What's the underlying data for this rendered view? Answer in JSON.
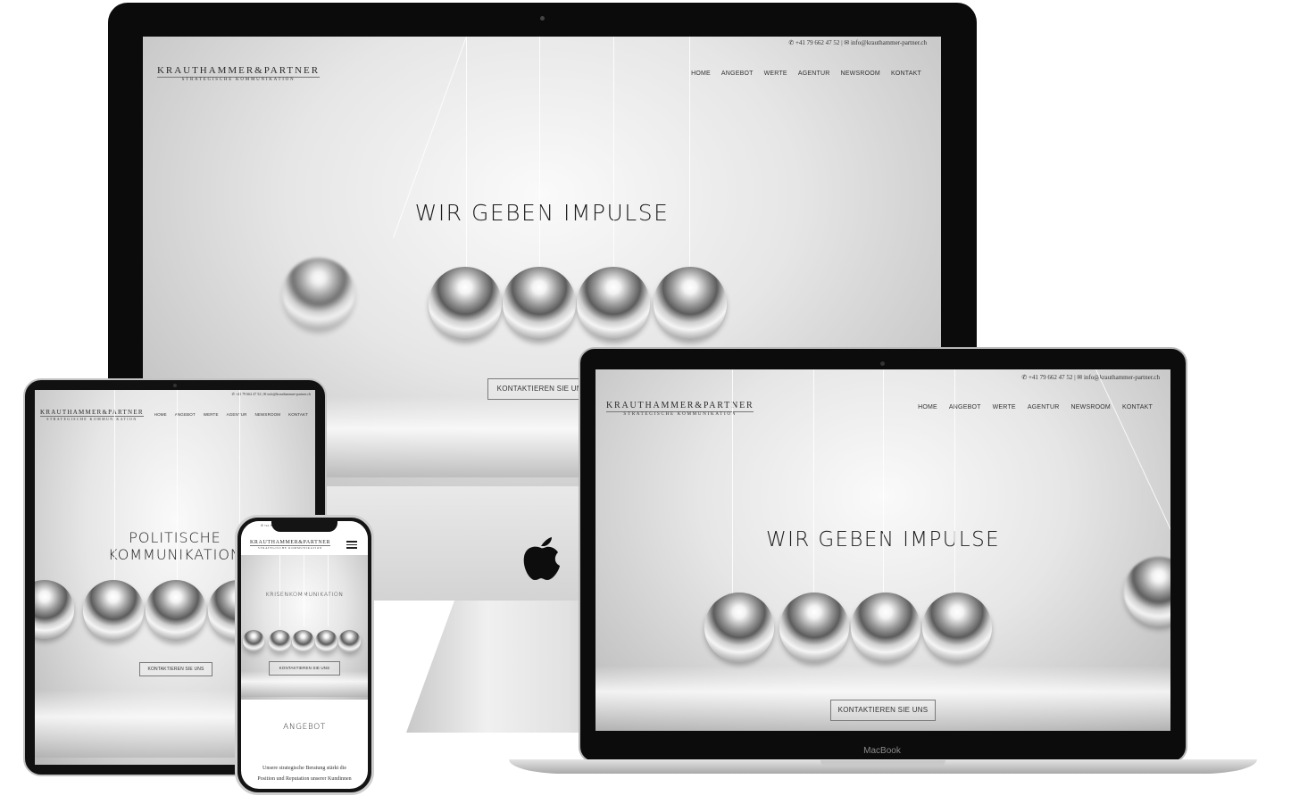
{
  "site": {
    "logo_main": "KRAUTHAMMER&PARTNER",
    "logo_sub": "STRATEGISCHE KOMMUNIKATION",
    "phone": "+41 79 662 47 52",
    "email": "info@krauthammer-partner.ch",
    "separator": "|",
    "nav": [
      "HOME",
      "ANGEBOT",
      "WERTE",
      "AGENTUR",
      "NEWSROOM",
      "KONTAKT"
    ],
    "cta": "KONTAKTIEREN SIE UNS"
  },
  "imac": {
    "hero": "WIR GEBEN IMPULSE"
  },
  "macbook": {
    "hero": "WIR GEBEN IMPULSE",
    "label": "MacBook"
  },
  "ipad": {
    "hero_line1": "POLITISCHE",
    "hero_line2": "KOMMUNIKATION"
  },
  "iphone": {
    "hero": "KRISENKOMMUNIKATION",
    "section_title": "ANGEBOT",
    "paragraph_line1": "Unsere strategische Beratung stärkt die",
    "paragraph_line2": "Position und Reputation unserer Kundinnen"
  },
  "icons": [
    "phone-icon",
    "mail-icon",
    "apple-logo-icon",
    "hamburger-menu-icon"
  ]
}
